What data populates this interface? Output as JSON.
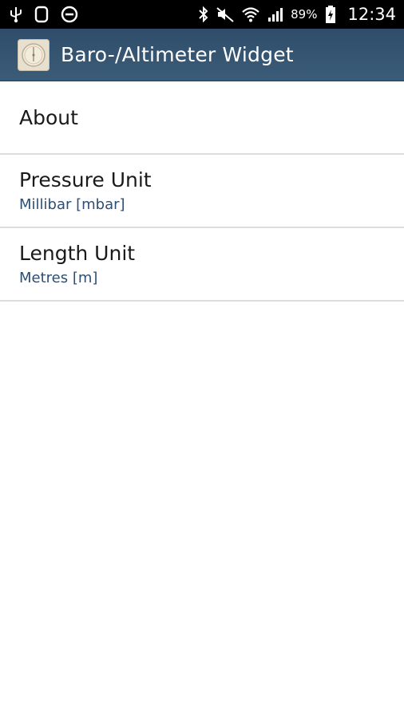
{
  "status_bar": {
    "battery_percent": "89%",
    "time": "12:34",
    "icons_left": [
      "usb-icon",
      "device-icon",
      "do-not-disturb-icon"
    ],
    "icons_right": [
      "bluetooth-icon",
      "mute-icon",
      "wifi-icon",
      "signal-icon",
      "battery-icon"
    ]
  },
  "action_bar": {
    "title": "Baro-/Altimeter Widget",
    "icon": "barometer-app-icon",
    "color": "#3a5a76"
  },
  "preferences": [
    {
      "title": "About"
    },
    {
      "title": "Pressure Unit",
      "summary": "Millibar [mbar]"
    },
    {
      "title": "Length Unit",
      "summary": "Metres [m]"
    }
  ],
  "colors": {
    "summary_text": "#2c4f73",
    "divider": "#dcdcdc"
  }
}
